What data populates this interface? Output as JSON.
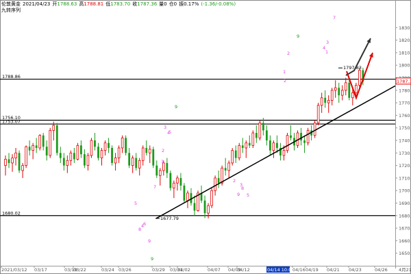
{
  "header": {
    "symbol": "伦敦黄金",
    "date": "2021/04/23",
    "open_label": "开",
    "open": "1788.63",
    "high_label": "高",
    "high": "1788.81",
    "low_label": "低",
    "low": "1783.70",
    "close_label": "收",
    "close": "1787.36",
    "volume": "量0",
    "position": "仓0",
    "amplitude": "振0.17%",
    "change": "(-1.36/-0.08%)",
    "subtitle": "九转序列"
  },
  "colors": {
    "up": "#e00000",
    "down": "#1a9a1a",
    "magenta": "#e040e0",
    "line": "#000000",
    "arrow_up": "#e00000",
    "arrow_dark": "#333333",
    "axis_text": "#555555",
    "bottom_highlight_bg": "#1040c0"
  },
  "chart_data": {
    "type": "candlestick",
    "y_range": [
      1640,
      1840
    ],
    "y_ticks": [
      1650,
      1660,
      1670,
      1680,
      1690,
      1700,
      1710,
      1720,
      1730,
      1740,
      1750,
      1760,
      1770,
      1780,
      1790,
      1800,
      1810,
      1820,
      1830
    ],
    "x_range": [
      0,
      105
    ],
    "x_ticks": [
      {
        "x": 0,
        "label": "2021/03/12"
      },
      {
        "x": 12,
        "label": "03/17"
      },
      {
        "x": 22,
        "label": "03/19"
      },
      {
        "x": 32,
        "label": "03/22"
      },
      {
        "x": 42,
        "label": "03/24"
      },
      {
        "x": 52,
        "label": "03/26"
      },
      {
        "x": 62,
        "label": "03/29"
      },
      {
        "x": 72,
        "label": "03/31"
      },
      {
        "x": 81,
        "label": "04/02"
      },
      {
        "x": 91,
        "label": "04/07"
      },
      {
        "x": 101,
        "label": "04/09"
      },
      {
        "x": 111,
        "label": "04/12"
      },
      {
        "x": 121,
        "label": "04/14 10:00",
        "highlight": true
      },
      {
        "x": 131,
        "label": "04/16"
      },
      {
        "x": 141,
        "label": "04/19"
      },
      {
        "x": 150,
        "label": "04/21"
      },
      {
        "x": 160,
        "label": "04/23"
      },
      {
        "x": 170,
        "label": "04/26"
      }
    ],
    "right_label": "4月21",
    "horizontal_levels": [
      {
        "value": 1788.86,
        "label": "1788.86"
      },
      {
        "value": 1756.1,
        "label": "1756.10"
      },
      {
        "value": 1753.07,
        "label": "1753.07"
      },
      {
        "value": 1680.02,
        "label": "1680.02"
      }
    ],
    "last_price": {
      "value": 1787.36,
      "label": "1787.36"
    },
    "annotations": [
      {
        "x": 68,
        "y": 1677.79,
        "label": "1677.79"
      },
      {
        "x": 146,
        "y": 1797.83,
        "label": "1797.83"
      }
    ],
    "trendline": {
      "from": [
        67,
        1677.8
      ],
      "to": [
        175,
        1789
      ]
    },
    "candles": [
      [
        1720,
        1728,
        1712,
        1725
      ],
      [
        1725,
        1730,
        1718,
        1722
      ],
      [
        1722,
        1729,
        1715,
        1726
      ],
      [
        1726,
        1734,
        1720,
        1730
      ],
      [
        1730,
        1732,
        1714,
        1716
      ],
      [
        1716,
        1722,
        1710,
        1720
      ],
      [
        1720,
        1736,
        1718,
        1735
      ],
      [
        1735,
        1740,
        1728,
        1732
      ],
      [
        1732,
        1738,
        1725,
        1736
      ],
      [
        1736,
        1742,
        1730,
        1734
      ],
      [
        1734,
        1745,
        1732,
        1744
      ],
      [
        1744,
        1746,
        1732,
        1735
      ],
      [
        1735,
        1740,
        1724,
        1728
      ],
      [
        1728,
        1750,
        1726,
        1748
      ],
      [
        1748,
        1755,
        1740,
        1752
      ],
      [
        1752,
        1754,
        1728,
        1730
      ],
      [
        1730,
        1735,
        1722,
        1726
      ],
      [
        1726,
        1730,
        1716,
        1720
      ],
      [
        1720,
        1728,
        1714,
        1724
      ],
      [
        1724,
        1732,
        1720,
        1730
      ],
      [
        1730,
        1734,
        1722,
        1725
      ],
      [
        1725,
        1738,
        1724,
        1736
      ],
      [
        1736,
        1740,
        1726,
        1729
      ],
      [
        1729,
        1733,
        1718,
        1720
      ],
      [
        1720,
        1730,
        1716,
        1728
      ],
      [
        1728,
        1742,
        1726,
        1740
      ],
      [
        1740,
        1746,
        1732,
        1735
      ],
      [
        1735,
        1738,
        1724,
        1726
      ],
      [
        1726,
        1734,
        1720,
        1732
      ],
      [
        1732,
        1740,
        1728,
        1738
      ],
      [
        1738,
        1742,
        1730,
        1734
      ],
      [
        1734,
        1736,
        1720,
        1722
      ],
      [
        1722,
        1730,
        1716,
        1726
      ],
      [
        1726,
        1736,
        1722,
        1734
      ],
      [
        1734,
        1744,
        1730,
        1742
      ],
      [
        1742,
        1744,
        1728,
        1730
      ],
      [
        1730,
        1734,
        1718,
        1720
      ],
      [
        1720,
        1728,
        1714,
        1726
      ],
      [
        1726,
        1730,
        1716,
        1718
      ],
      [
        1718,
        1726,
        1712,
        1724
      ],
      [
        1724,
        1736,
        1720,
        1734
      ],
      [
        1734,
        1740,
        1728,
        1730
      ],
      [
        1730,
        1736,
        1722,
        1733
      ],
      [
        1733,
        1735,
        1718,
        1720
      ],
      [
        1720,
        1724,
        1710,
        1712
      ],
      [
        1712,
        1718,
        1704,
        1716
      ],
      [
        1716,
        1724,
        1712,
        1722
      ],
      [
        1722,
        1726,
        1710,
        1714
      ],
      [
        1714,
        1716,
        1700,
        1702
      ],
      [
        1702,
        1708,
        1694,
        1706
      ],
      [
        1706,
        1712,
        1700,
        1710
      ],
      [
        1710,
        1714,
        1700,
        1704
      ],
      [
        1704,
        1706,
        1690,
        1692
      ],
      [
        1692,
        1700,
        1686,
        1698
      ],
      [
        1698,
        1702,
        1688,
        1690
      ],
      [
        1690,
        1696,
        1680,
        1684
      ],
      [
        1684,
        1700,
        1683,
        1698
      ],
      [
        1698,
        1704,
        1690,
        1692
      ],
      [
        1692,
        1696,
        1678,
        1682
      ],
      [
        1682,
        1690,
        1677.8,
        1688
      ],
      [
        1688,
        1702,
        1686,
        1700
      ],
      [
        1700,
        1712,
        1696,
        1710
      ],
      [
        1710,
        1716,
        1702,
        1706
      ],
      [
        1706,
        1720,
        1704,
        1718
      ],
      [
        1718,
        1726,
        1712,
        1716
      ],
      [
        1716,
        1724,
        1710,
        1722
      ],
      [
        1722,
        1734,
        1720,
        1732
      ],
      [
        1732,
        1736,
        1722,
        1726
      ],
      [
        1726,
        1738,
        1724,
        1736
      ],
      [
        1736,
        1742,
        1730,
        1734
      ],
      [
        1734,
        1740,
        1726,
        1738
      ],
      [
        1738,
        1744,
        1734,
        1736
      ],
      [
        1736,
        1748,
        1734,
        1746
      ],
      [
        1746,
        1752,
        1738,
        1742
      ],
      [
        1742,
        1756,
        1740,
        1754
      ],
      [
        1754,
        1758,
        1744,
        1748
      ],
      [
        1748,
        1752,
        1736,
        1740
      ],
      [
        1740,
        1744,
        1728,
        1732
      ],
      [
        1732,
        1740,
        1726,
        1738
      ],
      [
        1738,
        1744,
        1730,
        1734
      ],
      [
        1734,
        1738,
        1724,
        1728
      ],
      [
        1728,
        1736,
        1724,
        1732
      ],
      [
        1732,
        1746,
        1730,
        1744
      ],
      [
        1744,
        1752,
        1740,
        1742
      ],
      [
        1742,
        1746,
        1732,
        1736
      ],
      [
        1736,
        1748,
        1734,
        1746
      ],
      [
        1746,
        1750,
        1736,
        1740
      ],
      [
        1740,
        1744,
        1730,
        1738
      ],
      [
        1738,
        1750,
        1736,
        1748
      ],
      [
        1748,
        1752,
        1740,
        1744
      ],
      [
        1744,
        1756,
        1742,
        1754
      ],
      [
        1754,
        1770,
        1752,
        1768
      ],
      [
        1768,
        1778,
        1762,
        1774
      ],
      [
        1774,
        1780,
        1766,
        1770
      ],
      [
        1770,
        1776,
        1762,
        1772
      ],
      [
        1772,
        1782,
        1768,
        1780
      ],
      [
        1780,
        1788,
        1774,
        1782
      ],
      [
        1782,
        1786,
        1770,
        1776
      ],
      [
        1776,
        1784,
        1772,
        1780
      ],
      [
        1780,
        1790,
        1776,
        1786
      ],
      [
        1786,
        1790,
        1772,
        1774
      ],
      [
        1774,
        1782,
        1768,
        1778
      ],
      [
        1778,
        1786,
        1774,
        1784
      ],
      [
        1784,
        1798,
        1782,
        1796
      ],
      [
        1796,
        1798,
        1784,
        1787
      ]
    ],
    "td_labels": [
      {
        "x": 18,
        "y": 1688,
        "text": "9"
      },
      {
        "x": 52,
        "y": 1695,
        "text": "7"
      },
      {
        "x": 56,
        "y": 1678,
        "text": "5"
      },
      {
        "x": 57,
        "y": 1676,
        "text": "6"
      },
      {
        "x": 58,
        "y": 1673,
        "text": "4"
      },
      {
        "x": 60,
        "y": 1664,
        "text": "8"
      },
      {
        "x": 59,
        "y": 1648,
        "text": "9"
      },
      {
        "x": 62,
        "y": 1722,
        "text": "1"
      },
      {
        "x": 65,
        "y": 1750,
        "text": "3"
      },
      {
        "x": 67,
        "y": 1745,
        "text": "4"
      },
      {
        "x": 68,
        "y": 1751,
        "text": "5"
      },
      {
        "x": 70,
        "y": 1764,
        "text": "9"
      },
      {
        "x": 66,
        "y": 1717,
        "text": "2"
      },
      {
        "x": 98,
        "y": 1710,
        "text": "2"
      },
      {
        "x": 101,
        "y": 1706,
        "text": "3"
      },
      {
        "x": 103,
        "y": 1702,
        "text": "8"
      },
      {
        "x": 104,
        "y": 1700,
        "text": "9"
      },
      {
        "x": 90,
        "y": 1698,
        "text": "5"
      },
      {
        "x": 80,
        "y": 1802,
        "text": "9"
      },
      {
        "x": 78,
        "y": 1791,
        "text": "2"
      }
    ]
  }
}
